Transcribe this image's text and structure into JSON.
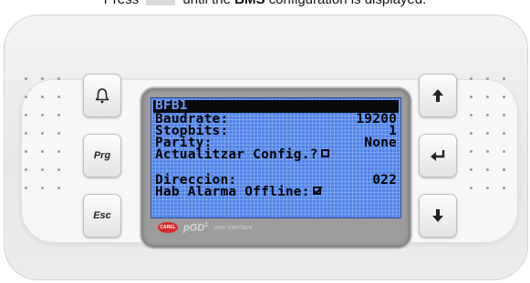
{
  "caption": {
    "prefix": "Press",
    "middle": "until the",
    "bold": "BMS",
    "suffix": "configuration is displayed."
  },
  "left_keys": {
    "alarm_icon": "bell-icon",
    "prg_label": "Prg",
    "esc_label": "Esc"
  },
  "right_keys": {
    "up_icon": "arrow-up-icon",
    "enter_icon": "enter-icon",
    "down_icon": "arrow-down-icon"
  },
  "display": {
    "title": "BFB1",
    "rows": [
      {
        "label": "Baudrate:",
        "value": "19200"
      },
      {
        "label": "Stopbits:",
        "value": "1"
      },
      {
        "label": "Parity:",
        "value": "None"
      }
    ],
    "update_config": {
      "label": "Actualitzar Config.?",
      "checked": false
    },
    "address": {
      "label": "Direccion:",
      "value": "022"
    },
    "alarm_offline": {
      "label": "Hab Alarma Offline:",
      "checked": true
    }
  },
  "branding": {
    "logo": "CAREL",
    "product": "pGD",
    "superscript": "1",
    "subtitle": "user interface"
  },
  "colors": {
    "lcd_background": "#4f84e8",
    "title_bar": "#0a0a0a",
    "title_text": "#6e9bff",
    "logo_red": "#d8282c"
  }
}
